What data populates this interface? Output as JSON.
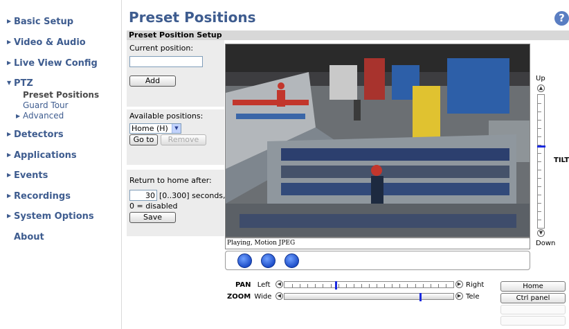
{
  "sidebar": {
    "items": [
      {
        "label": "Basic Setup"
      },
      {
        "label": "Video & Audio"
      },
      {
        "label": "Live View Config"
      },
      {
        "label": "PTZ"
      },
      {
        "label": "Detectors"
      },
      {
        "label": "Applications"
      },
      {
        "label": "Events"
      },
      {
        "label": "Recordings"
      },
      {
        "label": "System Options"
      },
      {
        "label": "About"
      }
    ],
    "ptz_sub": [
      {
        "label": "Preset Positions",
        "active": true
      },
      {
        "label": "Guard Tour"
      },
      {
        "label": "Advanced"
      }
    ]
  },
  "header": {
    "title": "Preset Positions",
    "help_symbol": "?"
  },
  "setup": {
    "section_title": "Preset Position Setup",
    "current_position_label": "Current position:",
    "current_position_value": "",
    "add_label": "Add",
    "available_positions_label": "Available positions:",
    "available_selected": "Home (H)",
    "goto_label": "Go to",
    "remove_label": "Remove",
    "return_home_label": "Return to home after:",
    "return_home_value": "30",
    "return_home_range": "[0..300] seconds,",
    "return_home_note": "0 = disabled",
    "save_label": "Save"
  },
  "video": {
    "status": "Playing, Motion JPEG"
  },
  "tilt": {
    "up": "Up",
    "down": "Down",
    "label": "TILT",
    "position": 0.38
  },
  "pan": {
    "label": "PAN",
    "left": "Left",
    "right": "Right",
    "position": 0.3
  },
  "zoom": {
    "label": "ZOOM",
    "wide": "Wide",
    "tele": "Tele",
    "position": 0.8
  },
  "right_buttons": {
    "home": "Home",
    "ctrl_panel": "Ctrl panel"
  },
  "colors": {
    "accent": "#3e5c8f",
    "slider_thumb": "#1a2adf"
  }
}
